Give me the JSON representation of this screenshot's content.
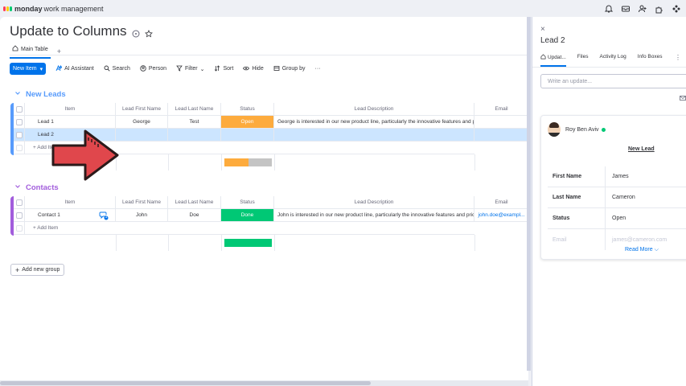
{
  "app": {
    "brand": "monday",
    "product": "work management"
  },
  "board": {
    "title": "Update to Columns",
    "tabs": {
      "main": "Main Table",
      "add": "+"
    }
  },
  "toolbar": {
    "new_item": "New Item",
    "ai_assistant": "AI Assistant",
    "search": "Search",
    "person": "Person",
    "filter": "Filter",
    "sort": "Sort",
    "hide": "Hide",
    "group_by": "Group by",
    "more": "···"
  },
  "columns": {
    "item": "Item",
    "first_name": "Lead First Name",
    "last_name": "Lead Last Name",
    "status": "Status",
    "description": "Lead Description",
    "email": "Email"
  },
  "groups": [
    {
      "name": "New Leads",
      "color": "#579bfc",
      "rows": [
        {
          "item": "Lead 1",
          "first": "George",
          "last": "Test",
          "status": "Open",
          "description": "George is interested in our new product line, particularly the innovative features and p...",
          "email": ""
        },
        {
          "item": "Lead 2",
          "first": "",
          "last": "",
          "status": "",
          "description": "",
          "email": ""
        }
      ],
      "add_item": "+ Add Item"
    },
    {
      "name": "Contacts",
      "color": "#a25ddc",
      "rows": [
        {
          "item": "Contact 1",
          "first": "John",
          "last": "Doe",
          "status": "Done",
          "description": "John is interested in our new product line, particularly the innovative features and prici...",
          "email": "john.doe@exampl..."
        }
      ],
      "add_item": "+ Add Item"
    }
  ],
  "update_badge": "1",
  "add_group": "Add new group",
  "panel": {
    "close": "×",
    "title": "Lead 2",
    "tabs": [
      "Updat...",
      "Files",
      "Activity Log",
      "Info Boxes"
    ],
    "more": "⋮",
    "update_placeholder": "Write an update...",
    "card": {
      "user": "Roy Ben Aviv",
      "link": "New Lead",
      "rows": [
        {
          "label": "First Name",
          "value": "James"
        },
        {
          "label": "Last Name",
          "value": "Cameron"
        },
        {
          "label": "Status",
          "value": "Open"
        },
        {
          "label": "Email",
          "value": "james@cameron.com"
        }
      ],
      "read_more": "Read More ⌵"
    }
  },
  "colors": {
    "accent": "#0073ea",
    "open": "#fdab3d",
    "done": "#00c875",
    "arrow": "#e0474c"
  }
}
